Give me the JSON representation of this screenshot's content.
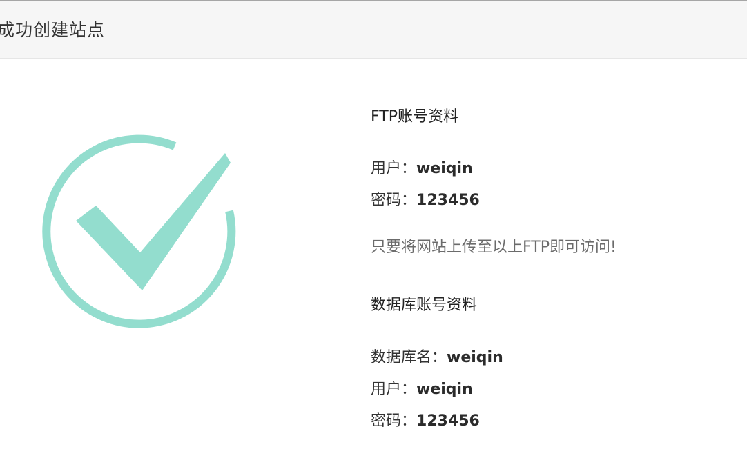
{
  "header": {
    "title": "成功创建站点"
  },
  "graphic": {
    "icon": "check-circle-icon",
    "color": "#93ddce"
  },
  "ftp": {
    "title": "FTP账号资料",
    "user_label": "用户：",
    "user_value": "weiqin",
    "pass_label": "密码：",
    "pass_value": "123456"
  },
  "notice": "只要将网站上传至以上FTP即可访问!",
  "database": {
    "title": "数据库账号资料",
    "name_label": "数据库名：",
    "name_value": "weiqin",
    "user_label": "用户：",
    "user_value": "weiqin",
    "pass_label": "密码：",
    "pass_value": "123456"
  }
}
